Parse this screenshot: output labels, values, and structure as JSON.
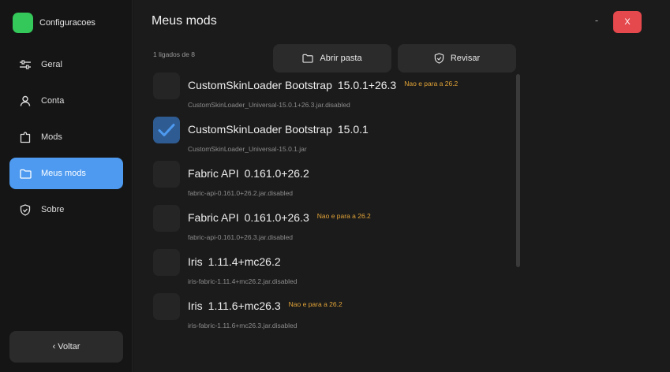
{
  "app": {
    "title": "Configuracoes",
    "logo_color": "#34c759"
  },
  "sidebar": {
    "items": [
      {
        "label": "Geral",
        "icon": "sliders-icon",
        "active": false
      },
      {
        "label": "Conta",
        "icon": "user-icon",
        "active": false
      },
      {
        "label": "Mods",
        "icon": "puzzle-icon",
        "active": false
      },
      {
        "label": "Meus mods",
        "icon": "folder-icon",
        "active": true
      },
      {
        "label": "Sobre",
        "icon": "shield-check-icon",
        "active": false
      }
    ],
    "back_label": "‹ Voltar",
    "active_color": "#4d9af0"
  },
  "header": {
    "title": "Meus mods",
    "minimize": "-",
    "close": "X",
    "close_color": "#e5484d"
  },
  "summary": {
    "enabled_count": "1 ligados de 8"
  },
  "toolbar": {
    "open_folder": "Abrir pasta",
    "review": "Revisar"
  },
  "mods": [
    {
      "name": "CustomSkinLoader Bootstrap",
      "version": "15.0.1+26.3",
      "warning": "Nao e para a 26.2",
      "file": "CustomSkinLoader_Universal-15.0.1+26.3.jar.disabled",
      "enabled": false
    },
    {
      "name": "CustomSkinLoader Bootstrap",
      "version": "15.0.1",
      "warning": "",
      "file": "CustomSkinLoader_Universal-15.0.1.jar",
      "enabled": true
    },
    {
      "name": "Fabric API",
      "version": "0.161.0+26.2",
      "warning": "",
      "file": "fabric-api-0.161.0+26.2.jar.disabled",
      "enabled": false
    },
    {
      "name": "Fabric API",
      "version": "0.161.0+26.3",
      "warning": "Nao e para a 26.2",
      "file": "fabric-api-0.161.0+26.3.jar.disabled",
      "enabled": false
    },
    {
      "name": "Iris",
      "version": "1.11.4+mc26.2",
      "warning": "",
      "file": "iris-fabric-1.11.4+mc26.2.jar.disabled",
      "enabled": false
    },
    {
      "name": "Iris",
      "version": "1.11.6+mc26.3",
      "warning": "Nao e para a 26.2",
      "file": "iris-fabric-1.11.6+mc26.3.jar.disabled",
      "enabled": false
    }
  ],
  "colors": {
    "warning": "#e3a437",
    "checked": "#2e5b91"
  }
}
